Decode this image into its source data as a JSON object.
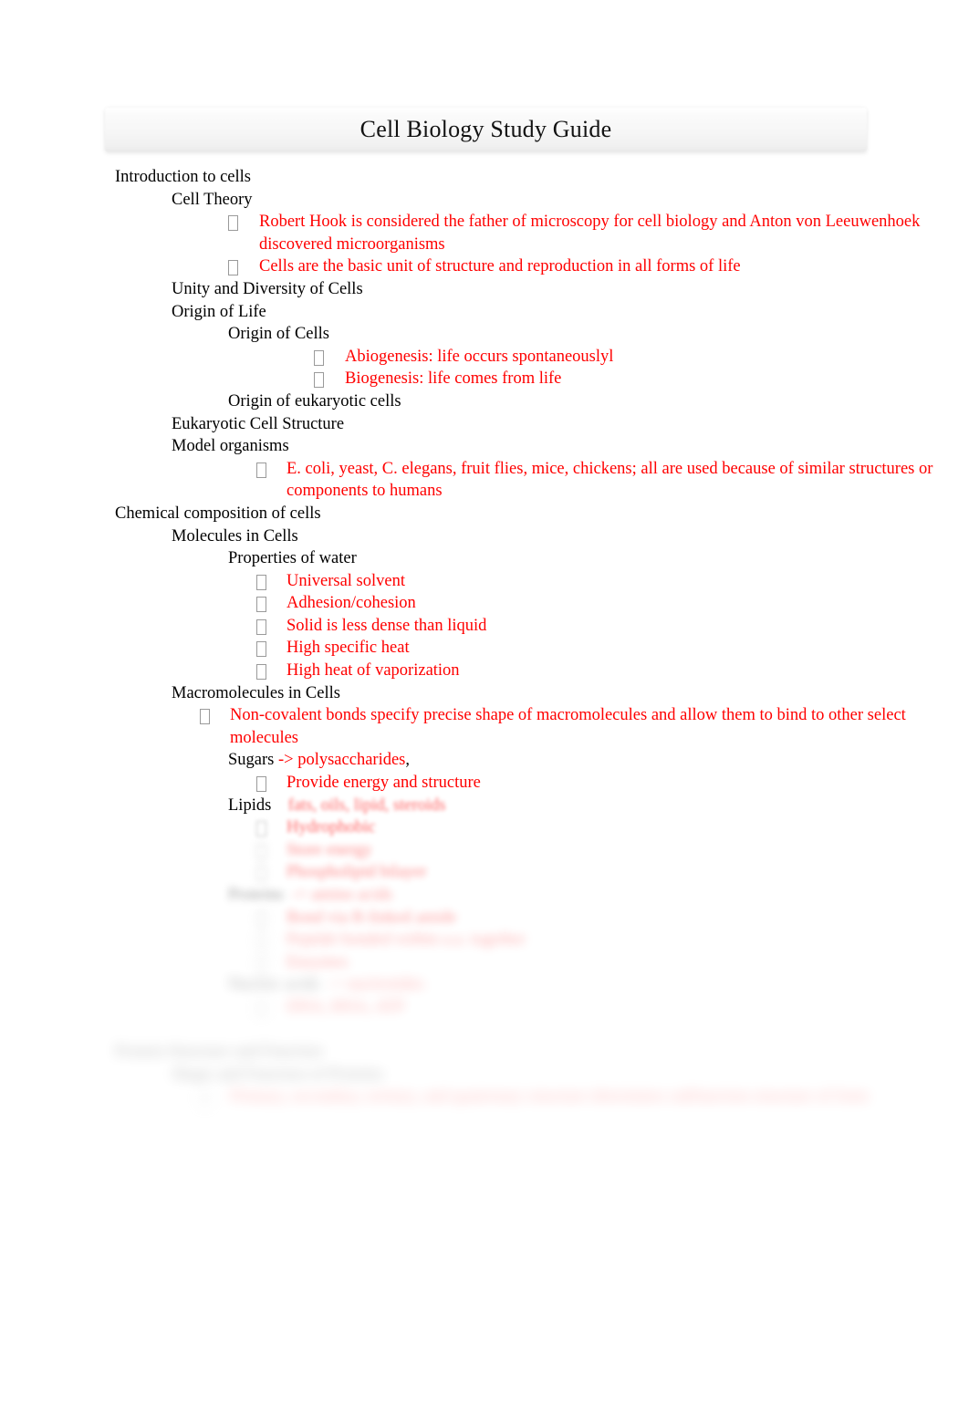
{
  "document": {
    "title": "Cell Biology Study Guide",
    "text_color": "#000000",
    "accent_color": "#ff0000",
    "background": "#ffffff"
  },
  "outline": {
    "l1_intro": "Introduction to cells",
    "l2_cell_theory": "Cell Theory",
    "b_robert_hook": "Robert Hook is considered the father of microscopy for cell biology and Anton von Leeuwenhoek discovered microorganisms",
    "b_cells_basic_unit": "Cells are the basic unit of structure and reproduction in all forms of life",
    "l2_unity": "Unity and Diversity of Cells",
    "l2_origin_life": "Origin of Life",
    "l3_origin_cells": "Origin of Cells",
    "b_abiogenesis": "Abiogenesis: life occurs spontaneouslyl",
    "b_biogenesis": "Biogenesis: life comes from life",
    "l3_origin_euk": "Origin of eukaryotic cells",
    "l2_euk_structure": "Eukaryotic Cell Structure",
    "l2_model_organisms": "Model organisms",
    "b_model_organisms": "E. coli, yeast, C. elegans, fruit flies, mice, chickens; all are used because of similar structures or components to humans",
    "l1_chemical": "Chemical composition of cells",
    "l2_molecules": "Molecules in Cells",
    "l3_properties_water": "Properties of water",
    "b_universal_solvent": "Universal solvent",
    "b_adhesion": "Adhesion/cohesion",
    "b_solid_less_dense": "Solid is less dense than liquid",
    "b_high_specific_heat": "High specific heat",
    "b_high_heat_vap": "High heat of vaporization",
    "l2_macromolecules": "Macromolecules in Cells",
    "b_noncovalent": "Non-covalent bonds specify precise shape of macromolecules and allow them to bind to other select molecules",
    "l3_sugars_black": "Sugars ",
    "l3_sugars_red": "-> polysaccharides",
    "l3_sugars_tail": ",",
    "b_provide_energy": "Provide energy and structure",
    "l3_lipids": "Lipids"
  }
}
